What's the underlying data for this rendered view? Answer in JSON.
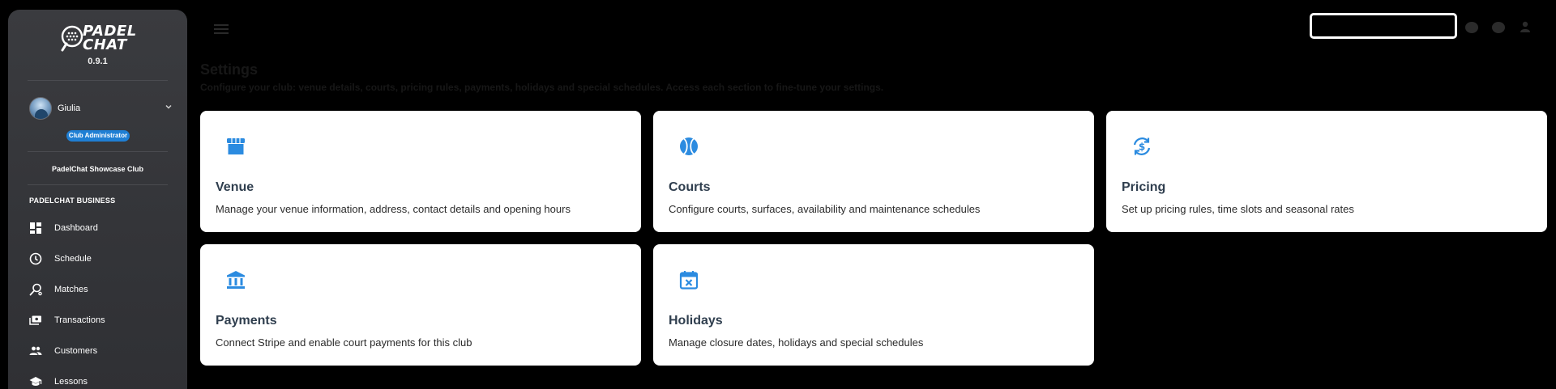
{
  "brand": {
    "name_line1": "PADEL",
    "name_line2": "CHAT",
    "version": "0.9.1"
  },
  "user": {
    "name": "Giulia",
    "role": "Club Administrator",
    "club": "PadelChat Showcase Club"
  },
  "nav": {
    "section": "PADELCHAT BUSINESS",
    "items": [
      {
        "label": "Dashboard",
        "icon": "dashboard-icon"
      },
      {
        "label": "Schedule",
        "icon": "clock-icon"
      },
      {
        "label": "Matches",
        "icon": "racket-icon"
      },
      {
        "label": "Transactions",
        "icon": "payments-icon"
      },
      {
        "label": "Customers",
        "icon": "people-icon"
      },
      {
        "label": "Lessons",
        "icon": "school-icon"
      }
    ]
  },
  "page": {
    "title": "Settings",
    "subtitle": "Configure your club: venue details, courts, pricing rules, payments, holidays and special schedules. Access each section to fine-tune your settings."
  },
  "cards": [
    {
      "title": "Venue",
      "description": "Manage your venue information, address, contact details and opening hours",
      "icon": "storefront-icon"
    },
    {
      "title": "Courts",
      "description": "Configure courts, surfaces, availability and maintenance schedules",
      "icon": "ball-icon"
    },
    {
      "title": "Pricing",
      "description": "Set up pricing rules, time slots and seasonal rates",
      "icon": "currency-exchange-icon"
    },
    {
      "title": "Payments",
      "description": "Connect Stripe and enable court payments for this club",
      "icon": "bank-icon"
    },
    {
      "title": "Holidays",
      "description": "Manage closure dates, holidays and special schedules",
      "icon": "event-busy-icon"
    }
  ],
  "colors": {
    "accent": "#1f7fd4",
    "sidebar": "#36373b",
    "card_title": "#2f3e4e",
    "icon_blue": "#2b8be0"
  }
}
